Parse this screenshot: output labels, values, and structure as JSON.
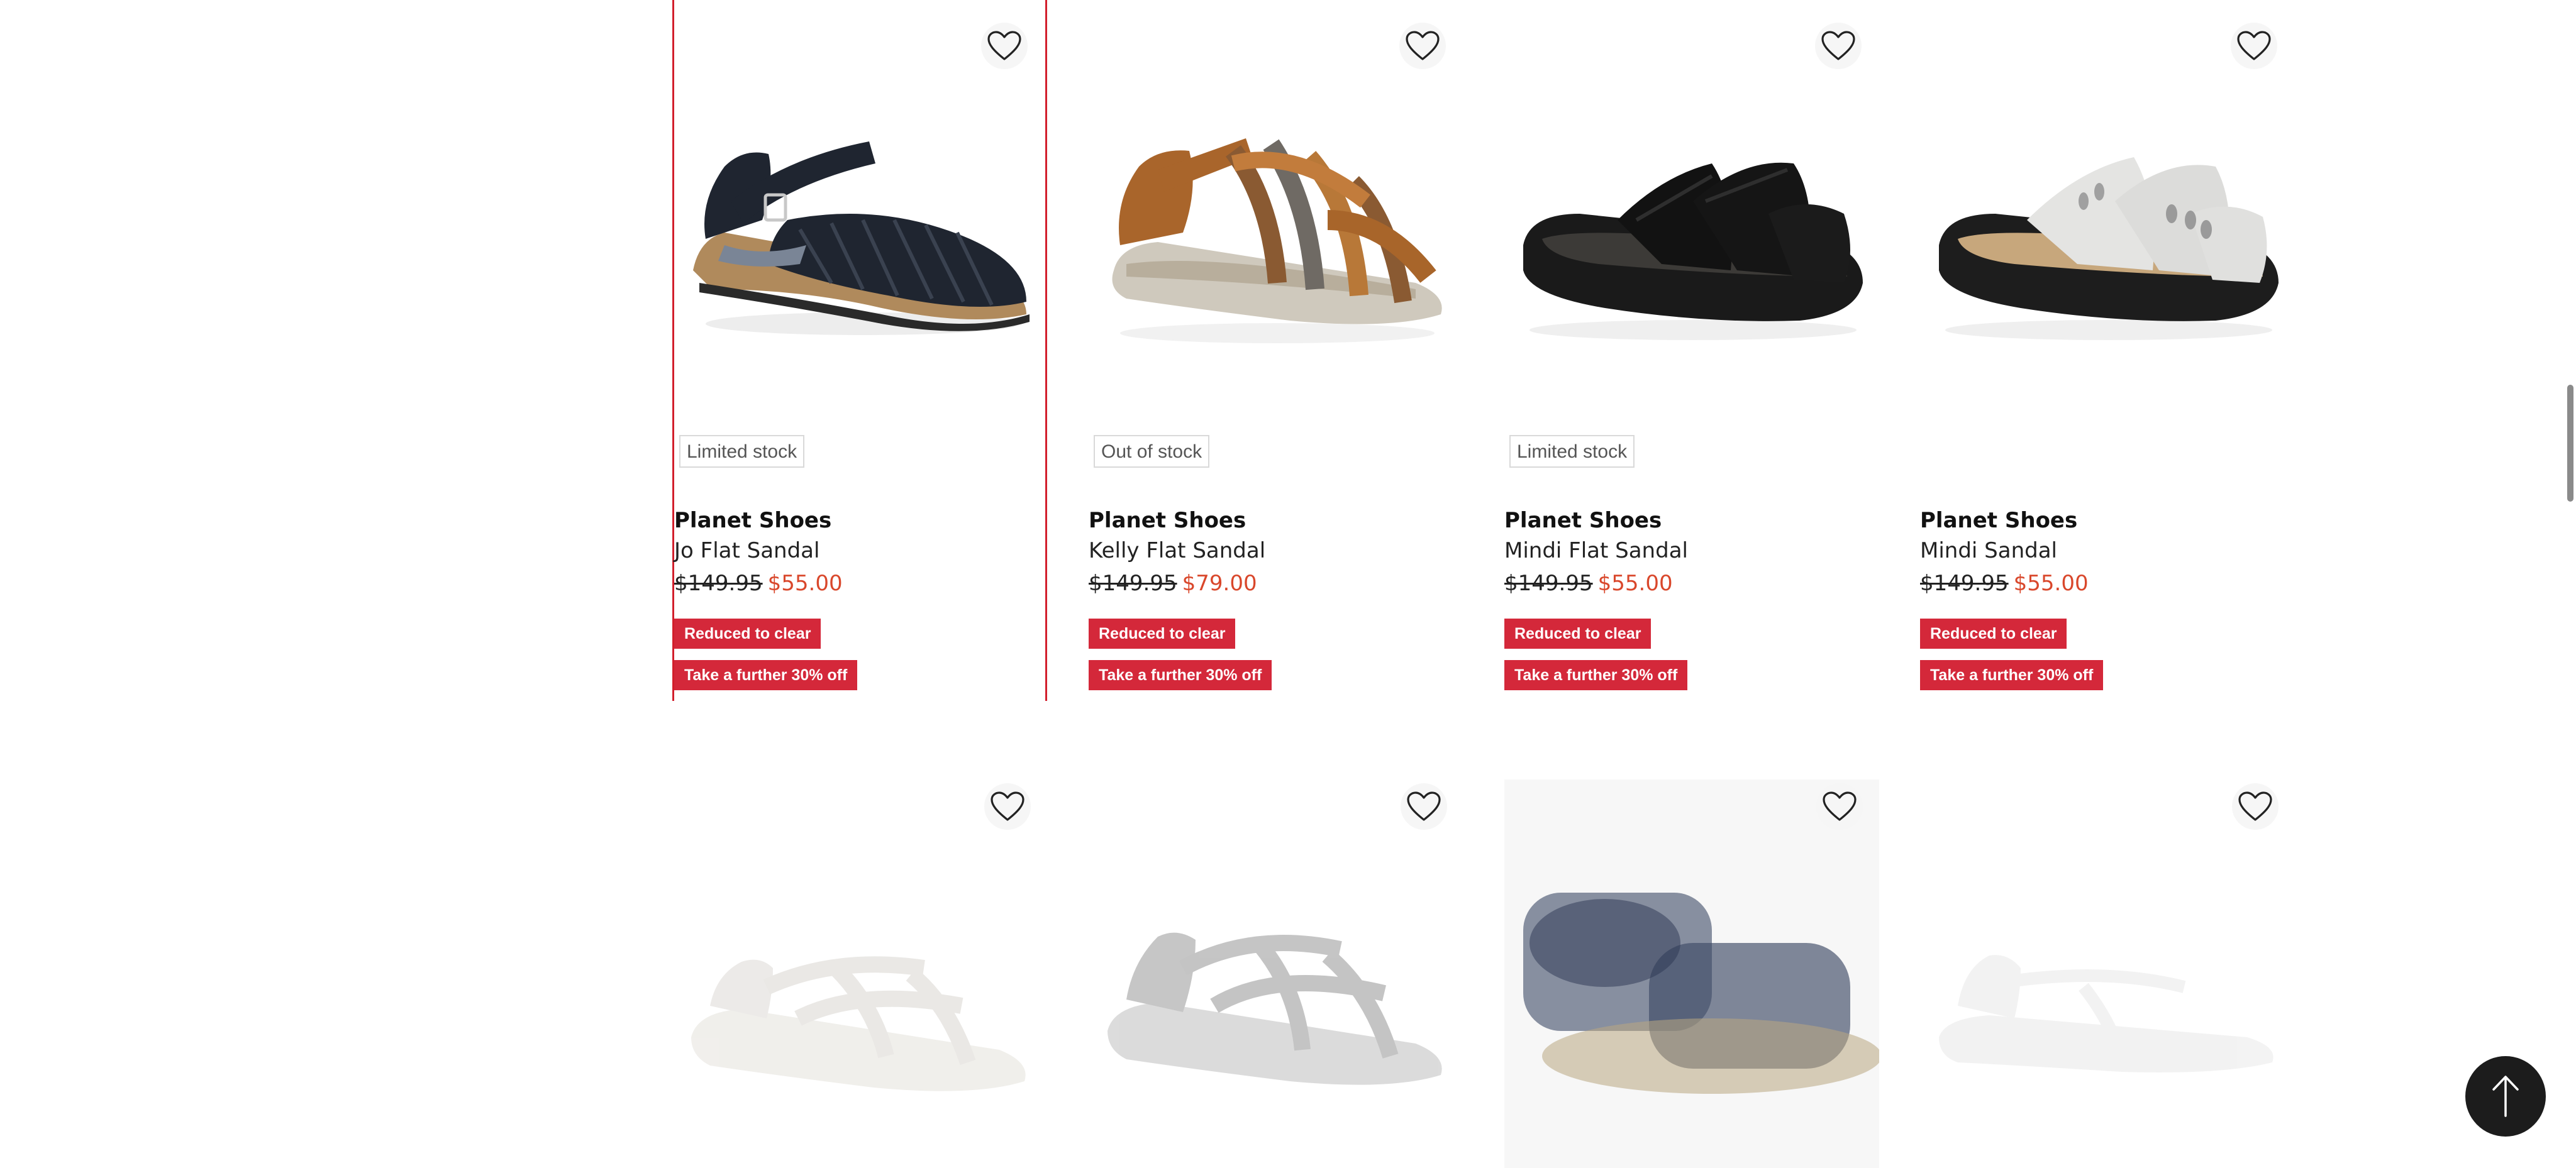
{
  "products": [
    {
      "brand": "Planet Shoes",
      "name": "Jo Flat Sandal",
      "stock": "Limited stock",
      "price_was": "$149.95",
      "price_now": "$55.00",
      "badges": [
        "Reduced to clear",
        "Take a further 30% off"
      ],
      "icon": "shoe-black-closed-sandal-icon",
      "focused": true
    },
    {
      "brand": "Planet Shoes",
      "name": "Kelly Flat Sandal",
      "stock": "Out of stock",
      "price_was": "$149.95",
      "price_now": "$79.00",
      "badges": [
        "Reduced to clear",
        "Take a further 30% off"
      ],
      "icon": "shoe-tan-strappy-sandal-icon",
      "focused": false
    },
    {
      "brand": "Planet Shoes",
      "name": "Mindi Flat Sandal",
      "stock": "Limited stock",
      "price_was": "$149.95",
      "price_now": "$55.00",
      "badges": [
        "Reduced to clear",
        "Take a further 30% off"
      ],
      "icon": "shoe-black-slide-icon",
      "focused": false
    },
    {
      "brand": "Planet Shoes",
      "name": "Mindi Sandal",
      "stock": "",
      "price_was": "$149.95",
      "price_now": "$55.00",
      "badges": [
        "Reduced to clear",
        "Take a further 30% off"
      ],
      "icon": "shoe-white-slide-icon",
      "focused": false
    }
  ],
  "next_row_images": [
    {
      "icon": "shoe-white-sandal-icon"
    },
    {
      "icon": "shoe-grey-sandal-icon"
    },
    {
      "icon": "shoe-blurred-sandal-icon"
    },
    {
      "icon": "shoe-faint-sandal-icon"
    }
  ],
  "icons": {
    "wishlist": "heart-outline-icon",
    "back_to_top": "arrow-up-icon"
  },
  "colors": {
    "sale_badge": "#d4283a",
    "sale_price": "#d9472b",
    "focus_outline": "#d21f2c"
  }
}
